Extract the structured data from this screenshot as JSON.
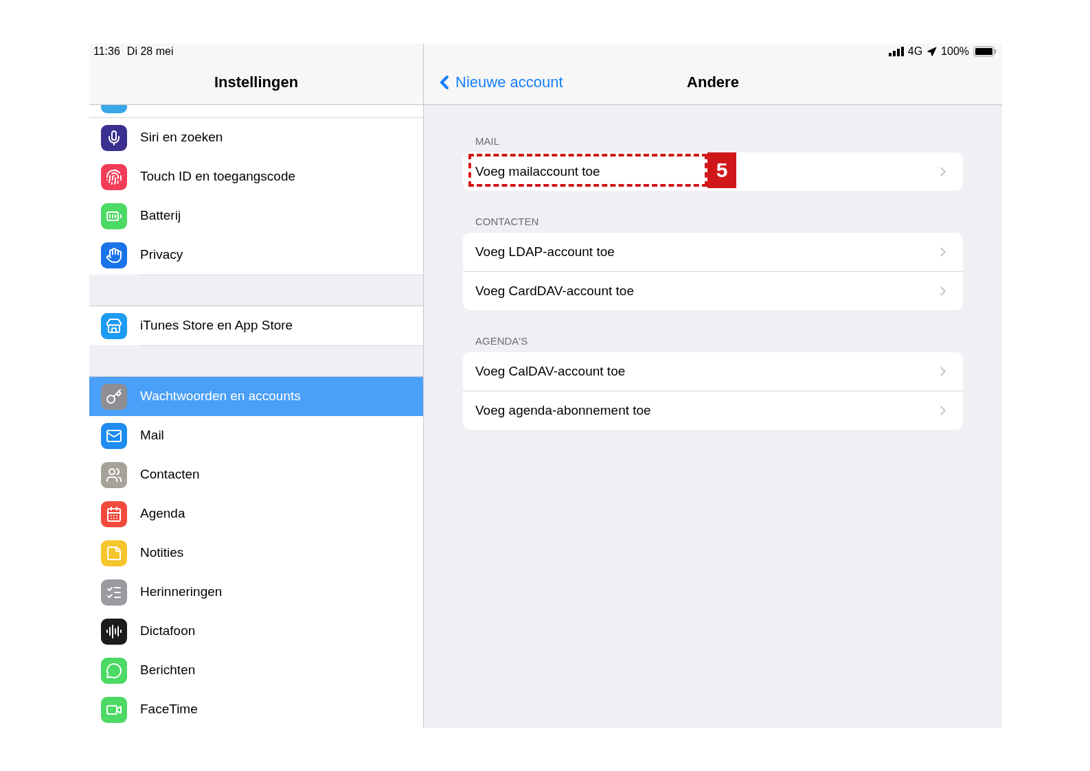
{
  "status_bar": {
    "time": "11:36",
    "date": "Di 28 mei",
    "network": "4G",
    "battery": "100%"
  },
  "sidebar": {
    "title": "Instellingen",
    "groups": [
      {
        "items": [
          {
            "label": "Siri en zoeken",
            "kind": "siri",
            "selected": false
          },
          {
            "label": "Touch ID en toegangscode",
            "kind": "fingerprint",
            "selected": false
          },
          {
            "label": "Batterij",
            "kind": "battery",
            "selected": false
          },
          {
            "label": "Privacy",
            "kind": "hand",
            "selected": false
          }
        ]
      },
      {
        "items": [
          {
            "label": "iTunes Store en App Store",
            "kind": "appstore",
            "selected": false
          }
        ]
      },
      {
        "items": [
          {
            "label": "Wachtwoorden en accounts",
            "kind": "key",
            "selected": true
          },
          {
            "label": "Mail",
            "kind": "mail",
            "selected": false
          },
          {
            "label": "Contacten",
            "kind": "contacts",
            "selected": false
          },
          {
            "label": "Agenda",
            "kind": "calendar",
            "selected": false
          },
          {
            "label": "Notities",
            "kind": "notes",
            "selected": false
          },
          {
            "label": "Herinneringen",
            "kind": "reminders",
            "selected": false
          },
          {
            "label": "Dictafoon",
            "kind": "voice",
            "selected": false
          },
          {
            "label": "Berichten",
            "kind": "messages",
            "selected": false
          },
          {
            "label": "FaceTime",
            "kind": "video",
            "selected": false
          }
        ]
      }
    ]
  },
  "detail": {
    "back": "Nieuwe account",
    "title": "Andere",
    "sections": [
      {
        "header": "MAIL",
        "rows": [
          {
            "label": "Voeg mailaccount toe",
            "callout": "5"
          }
        ]
      },
      {
        "header": "CONTACTEN",
        "rows": [
          {
            "label": "Voeg LDAP-account toe"
          },
          {
            "label": "Voeg CardDAV-account toe"
          }
        ]
      },
      {
        "header": "AGENDA'S",
        "rows": [
          {
            "label": "Voeg CalDAV-account toe"
          },
          {
            "label": "Voeg agenda-abonnement toe"
          }
        ]
      }
    ]
  }
}
